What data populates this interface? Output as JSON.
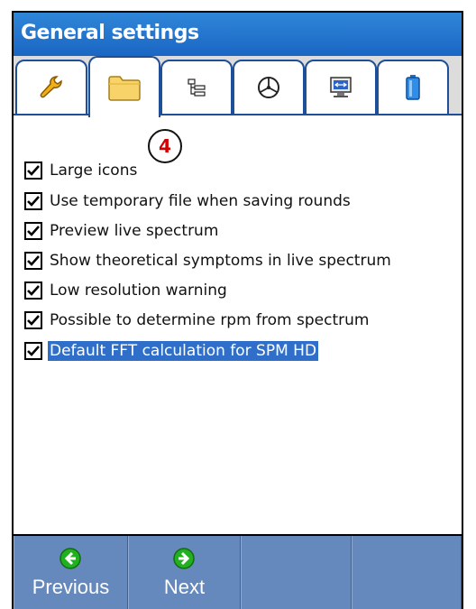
{
  "window": {
    "title": "General settings"
  },
  "tabs": [
    {
      "icon": "wrench-icon",
      "active": false
    },
    {
      "icon": "folder-icon",
      "active": true
    },
    {
      "icon": "tree-list-icon",
      "active": false
    },
    {
      "icon": "dial-icon",
      "active": false
    },
    {
      "icon": "monitor-icon",
      "active": false
    },
    {
      "icon": "battery-icon",
      "active": false
    }
  ],
  "options": [
    {
      "label": "Large icons",
      "checked": true,
      "selected": false
    },
    {
      "label": "Use temporary file when saving rounds",
      "checked": true,
      "selected": false
    },
    {
      "label": "Preview live spectrum",
      "checked": true,
      "selected": false
    },
    {
      "label": "Show theoretical symptoms in live spectrum",
      "checked": true,
      "selected": false
    },
    {
      "label": "Low resolution warning",
      "checked": true,
      "selected": false
    },
    {
      "label": "Possible to determine rpm from spectrum",
      "checked": true,
      "selected": false
    },
    {
      "label": "Default FFT calculation for SPM HD",
      "checked": true,
      "selected": true
    }
  ],
  "annotation": {
    "badge": "4"
  },
  "toolbar": {
    "previous_label": "Previous",
    "next_label": "Next"
  },
  "colors": {
    "title_bar": "#1a66c4",
    "tab_border": "#1f4f99",
    "selection": "#2f6fc9",
    "bottom_bar": "#6588bd",
    "nav_icon": "#22b020",
    "badge_text": "#d40000"
  }
}
